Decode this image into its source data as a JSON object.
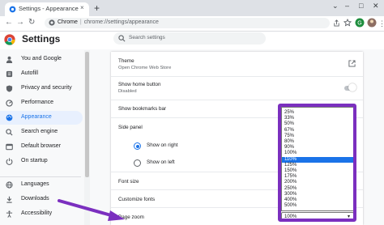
{
  "browser": {
    "tab_title": "Settings - Appearance",
    "tab_close": "×",
    "new_tab": "+",
    "address_host": "Chrome",
    "address_separator": "|",
    "address_path": "chrome://settings/appearance",
    "window_buttons": [
      "⌄",
      "–",
      "□",
      "✕"
    ]
  },
  "header": {
    "title": "Settings",
    "search_placeholder": "Search settings"
  },
  "sidebar": {
    "items": [
      {
        "label": "You and Google",
        "icon": "person-icon"
      },
      {
        "label": "Autofill",
        "icon": "autofill-icon"
      },
      {
        "label": "Privacy and security",
        "icon": "shield-icon"
      },
      {
        "label": "Performance",
        "icon": "performance-icon"
      },
      {
        "label": "Appearance",
        "icon": "palette-icon",
        "active": true
      },
      {
        "label": "Search engine",
        "icon": "search-icon"
      },
      {
        "label": "Default browser",
        "icon": "browser-icon"
      },
      {
        "label": "On startup",
        "icon": "power-icon"
      },
      {
        "label": "Languages",
        "icon": "globe-icon"
      },
      {
        "label": "Downloads",
        "icon": "download-icon"
      },
      {
        "label": "Accessibility",
        "icon": "accessibility-icon"
      }
    ]
  },
  "appearance": {
    "theme_label": "Theme",
    "theme_sub": "Open Chrome Web Store",
    "home_button_label": "Show home button",
    "home_button_sub": "Disabled",
    "bookmarks_bar_label": "Show bookmarks bar",
    "side_panel_label": "Side panel",
    "side_panel_right": "Show on right",
    "side_panel_left": "Show on left",
    "font_size_label": "Font size",
    "customize_fonts_label": "Customize fonts",
    "page_zoom_label": "Page zoom"
  },
  "zoom": {
    "options": [
      "25%",
      "33%",
      "50%",
      "67%",
      "75%",
      "80%",
      "90%",
      "100%",
      "110%",
      "125%",
      "150%",
      "175%",
      "200%",
      "250%",
      "300%",
      "400%",
      "500%"
    ],
    "selected": "110%",
    "current_value": "100%",
    "caret": "▾"
  },
  "colors": {
    "accent": "#1a73e8",
    "highlight": "#7b2fbf",
    "arrow": "#7b2fbf"
  }
}
